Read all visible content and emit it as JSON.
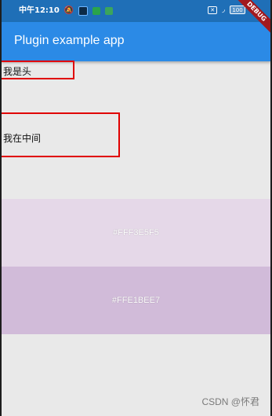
{
  "status_bar": {
    "time": "中午12:10",
    "battery": "100",
    "color": "#1f6fb7"
  },
  "app_bar": {
    "title": "Plugin example app",
    "color": "#2b8ae6"
  },
  "debug_ribbon": {
    "label": "DEBUG"
  },
  "content": {
    "header_text": "我是头",
    "middle_text": "我在中间",
    "highlight_color": "#e00000"
  },
  "color_bands": [
    {
      "label": "#FFF3E5F5",
      "color": "#e5d8e8"
    },
    {
      "label": "#FFE1BEE7",
      "color": "#d1bbd9"
    }
  ],
  "watermark": "CSDN @怀君"
}
